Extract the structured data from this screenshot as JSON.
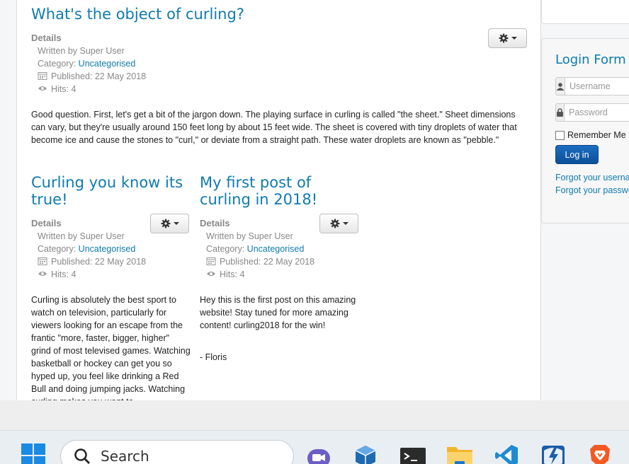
{
  "article_main": {
    "title": "What's the object of curling?",
    "details": "Details",
    "author": "Written by Super User",
    "category_prefix": "Category: ",
    "category": "Uncategorised",
    "published": "Published: 22 May 2018",
    "hits": "Hits: 4",
    "body": "Good question. First, let's get a bit of the jargon down. The playing surface in curling is called \"the sheet.\" Sheet dimensions can vary, but they're usually around 150 feet long by about 15 feet wide. The sheet is covered with tiny droplets of water that become ice and cause the stones to \"curl,\" or deviate from a straight path. These water droplets are known as \"pebble.\""
  },
  "article_left": {
    "title": "Curling you know its true!",
    "details": "Details",
    "author": "Written by Super User",
    "category_prefix": "Category: ",
    "category": "Uncategorised",
    "published": "Published: 22 May 2018",
    "hits": "Hits: 4",
    "body": "Curling is absolutely the best sport to watch on television, particularly for viewers looking for an escape from the frantic \"more, faster, bigger, higher\" grind of most televised games. Watching basketball or hockey can get you so hyped up, you feel like drinking a Red Bull and doing jumping jacks. Watching curling makes you want to"
  },
  "article_right": {
    "title": "My first post of curling in 2018!",
    "details": "Details",
    "author": "Written by Super User",
    "category_prefix": "Category: ",
    "category": "Uncategorised",
    "published": "Published: 22 May 2018",
    "hits": "Hits: 4",
    "body": "Hey this is the first post on this amazing website! Stay tuned for more amazing content! curling2018 for the win!",
    "signature": "- Floris"
  },
  "login": {
    "title": "Login Form",
    "username_placeholder": "Username",
    "password_placeholder": "Password",
    "remember": "Remember Me",
    "button": "Log in",
    "forgot_username": "Forgot your username?",
    "forgot_password": "Forgot your password?"
  },
  "taskbar": {
    "search_placeholder": "Search",
    "apps": [
      "windows-start",
      "search",
      "teams-meet",
      "virtualbox",
      "terminal",
      "file-explorer",
      "vscode",
      "wireshark",
      "brave"
    ]
  },
  "colors": {
    "link": "#0f7bb0",
    "meta_text": "#888888",
    "login_button": "#1565b8"
  }
}
